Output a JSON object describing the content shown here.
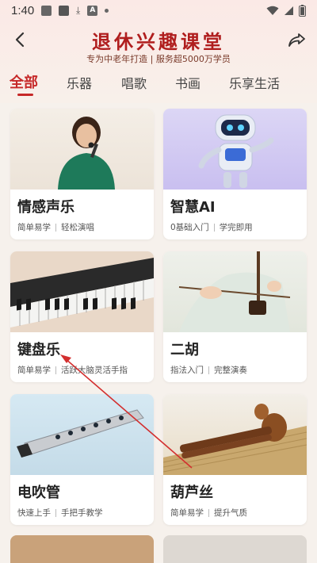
{
  "status": {
    "time": "1:40"
  },
  "header": {
    "title": "退休兴趣课堂",
    "subtitle": "专为中老年打造 | 服务超5000万学员"
  },
  "tabs": [
    {
      "label": "全部",
      "active": true
    },
    {
      "label": "乐器"
    },
    {
      "label": "唱歌"
    },
    {
      "label": "书画"
    },
    {
      "label": "乐享生活"
    }
  ],
  "courses": [
    {
      "name": "情感声乐",
      "tag1": "简单易学",
      "tag2": "轻松演唱"
    },
    {
      "name": "智慧AI",
      "tag1": "0基础入门",
      "tag2": "学完即用"
    },
    {
      "name": "键盘乐",
      "tag1": "简单易学",
      "tag2": "活跃大脑灵活手指"
    },
    {
      "name": "二胡",
      "tag1": "指法入门",
      "tag2": "完整演奏"
    },
    {
      "name": "电吹管",
      "tag1": "快速上手",
      "tag2": "手把手教学"
    },
    {
      "name": "葫芦丝",
      "tag1": "简单易学",
      "tag2": "提升气质"
    }
  ],
  "colors": {
    "accent": "#c62828",
    "title": "#b01e1e",
    "annotation_arrow": "#d32f2f"
  }
}
